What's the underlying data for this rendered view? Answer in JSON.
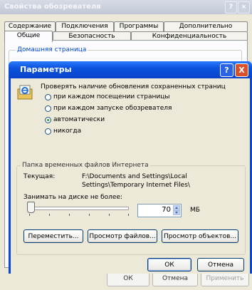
{
  "outer_window": {
    "title": "Свойства обозревателя",
    "tabs_row1": [
      "Содержание",
      "Подключения",
      "Программы",
      "Дополнительно"
    ],
    "tabs_row2": [
      "Общие",
      "Безопасность",
      "Конфиденциальность"
    ],
    "active_tab": "Общие",
    "home_page_group": "Домашняя страница",
    "buttons": {
      "ok": "ОК",
      "cancel": "Отмена",
      "apply": "Применить"
    }
  },
  "dialog": {
    "title": "Параметры",
    "help_button": "?",
    "close_button": "X",
    "check_updates_label": "Проверять наличие обновления сохраненных страниц",
    "radio_options": [
      {
        "label": "при каждом посещении страницы",
        "checked": false
      },
      {
        "label": "при каждом запуске обозревателя",
        "checked": false
      },
      {
        "label": "автоматически",
        "checked": true
      },
      {
        "label": "никогда",
        "checked": false
      }
    ],
    "temp_files_group": "Папка временных файлов Интернета",
    "current_folder_label": "Текущая:",
    "current_folder_path_line1": "F:\\Documents and Settings\\Local",
    "current_folder_path_line2": "Settings\\Temporary Internet Files\\",
    "disk_usage_label": "Занимать на диске не более:",
    "disk_usage_value": "70",
    "disk_usage_unit": "МБ",
    "slider_fraction": 0.02,
    "buttons": {
      "move": "Переместить...",
      "view_files": "Просмотр файлов...",
      "view_objects": "Просмотр объектов...",
      "ok": "ОК",
      "cancel": "Отмена"
    }
  },
  "colors": {
    "dialog_titlebar": "#0a52dd",
    "window_face": "#ece9d8",
    "close_button": "#d8512b",
    "radio_checked": "#21a121"
  }
}
